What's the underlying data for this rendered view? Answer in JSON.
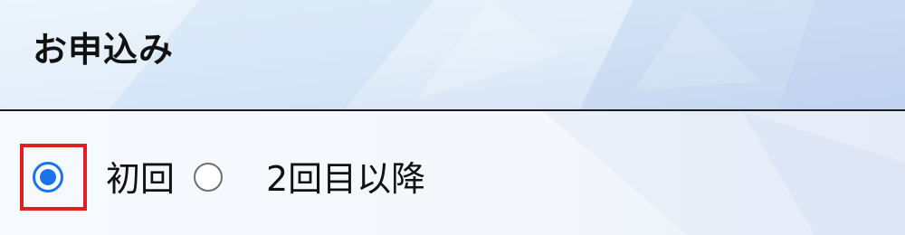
{
  "header": {
    "title": "お申込み"
  },
  "options": {
    "selected_value": "初回",
    "items": [
      {
        "label": "初回",
        "checked": true
      },
      {
        "label": "2回目以降",
        "checked": false
      }
    ]
  },
  "colors": {
    "radio_accent": "#1a73e8",
    "highlight_border": "#e02020",
    "divider": "#1a1a1a"
  }
}
